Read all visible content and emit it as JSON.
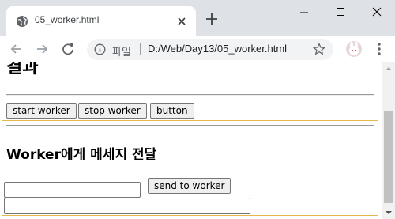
{
  "browser": {
    "tab": {
      "title": "05_worker.html"
    },
    "omnibox": {
      "scheme_label": "파일",
      "url": "D:/Web/Day13/05_worker.html"
    }
  },
  "page": {
    "result_heading": "결과",
    "buttons": {
      "start": "start worker",
      "stop": "stop worker",
      "generic": "button"
    },
    "worker_section": {
      "heading": "Worker에게 메세지 전달",
      "message_input": {
        "value": "",
        "placeholder": ""
      },
      "send_button": "send to worker",
      "output": {
        "value": ""
      }
    }
  },
  "colors": {
    "tabstrip": "#dee1e6",
    "omnibox": "#f1f3f4",
    "worker_border": "#e6b84a"
  }
}
